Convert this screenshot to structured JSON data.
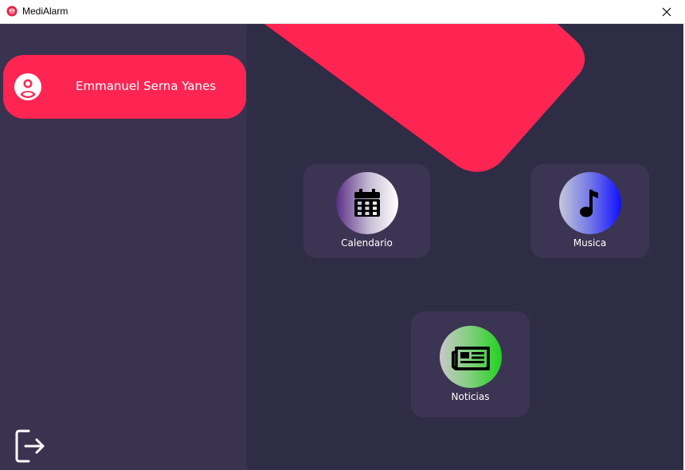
{
  "window": {
    "title": "MediAlarm"
  },
  "sidebar": {
    "user_name": "Emmanuel Serna Yanes"
  },
  "tiles": {
    "calendar": {
      "label": "Calendario"
    },
    "music": {
      "label": "Musica"
    },
    "news": {
      "label": "Noticias"
    }
  },
  "colors": {
    "accent": "#ff2552",
    "sidebar_bg": "#3a3350",
    "main_bg": "#2f2c45",
    "tile_bg": "#3b3452"
  },
  "icons": {
    "app": "medialarm-app-icon",
    "close": "close-icon",
    "avatar": "user-avatar-icon",
    "calendar": "calendar-icon",
    "music": "music-note-icon",
    "news": "newspaper-icon",
    "logout": "logout-icon"
  }
}
